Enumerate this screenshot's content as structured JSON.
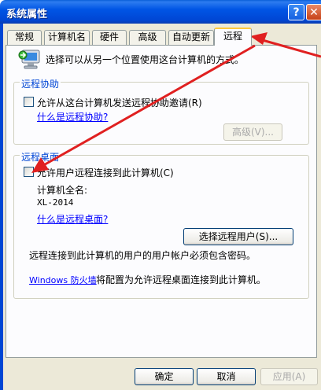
{
  "window": {
    "title": "系统属性",
    "help_label": "?",
    "close_label": "✕"
  },
  "tabs": [
    {
      "label": "常规",
      "active": false
    },
    {
      "label": "计算机名",
      "active": false
    },
    {
      "label": "硬件",
      "active": false
    },
    {
      "label": "高级",
      "active": false
    },
    {
      "label": "自动更新",
      "active": false
    },
    {
      "label": "远程",
      "active": true
    }
  ],
  "intro_text": "选择可以从另一个位置使用这台计算机的方式。",
  "remote_assistance": {
    "legend": "远程协助",
    "checkbox_label": "允许从这台计算机发送远程协助邀请(R)",
    "checked": false,
    "help_link": "什么是远程协助?",
    "advanced_button": "高级(V)..."
  },
  "remote_desktop": {
    "legend": "远程桌面",
    "checkbox_label": "允许用户远程连接到此计算机(C)",
    "checked": false,
    "full_name_label": "计算机全名:",
    "full_name_value": "XL-2014",
    "help_link": "什么是远程桌面?",
    "select_users_button": "选择远程用户(S)...",
    "password_note": "远程连接到此计算机的用户的用户帐户必须包含密码。",
    "firewall_link": "Windows 防火墙",
    "firewall_note": "将配置为允许远程桌面连接到此计算机。"
  },
  "footer": {
    "ok": "确定",
    "cancel": "取消",
    "apply": "应用(A)"
  },
  "colors": {
    "annotation_arrow": "#e02020",
    "titlebar": "#0055e5",
    "link": "#0000ff"
  }
}
